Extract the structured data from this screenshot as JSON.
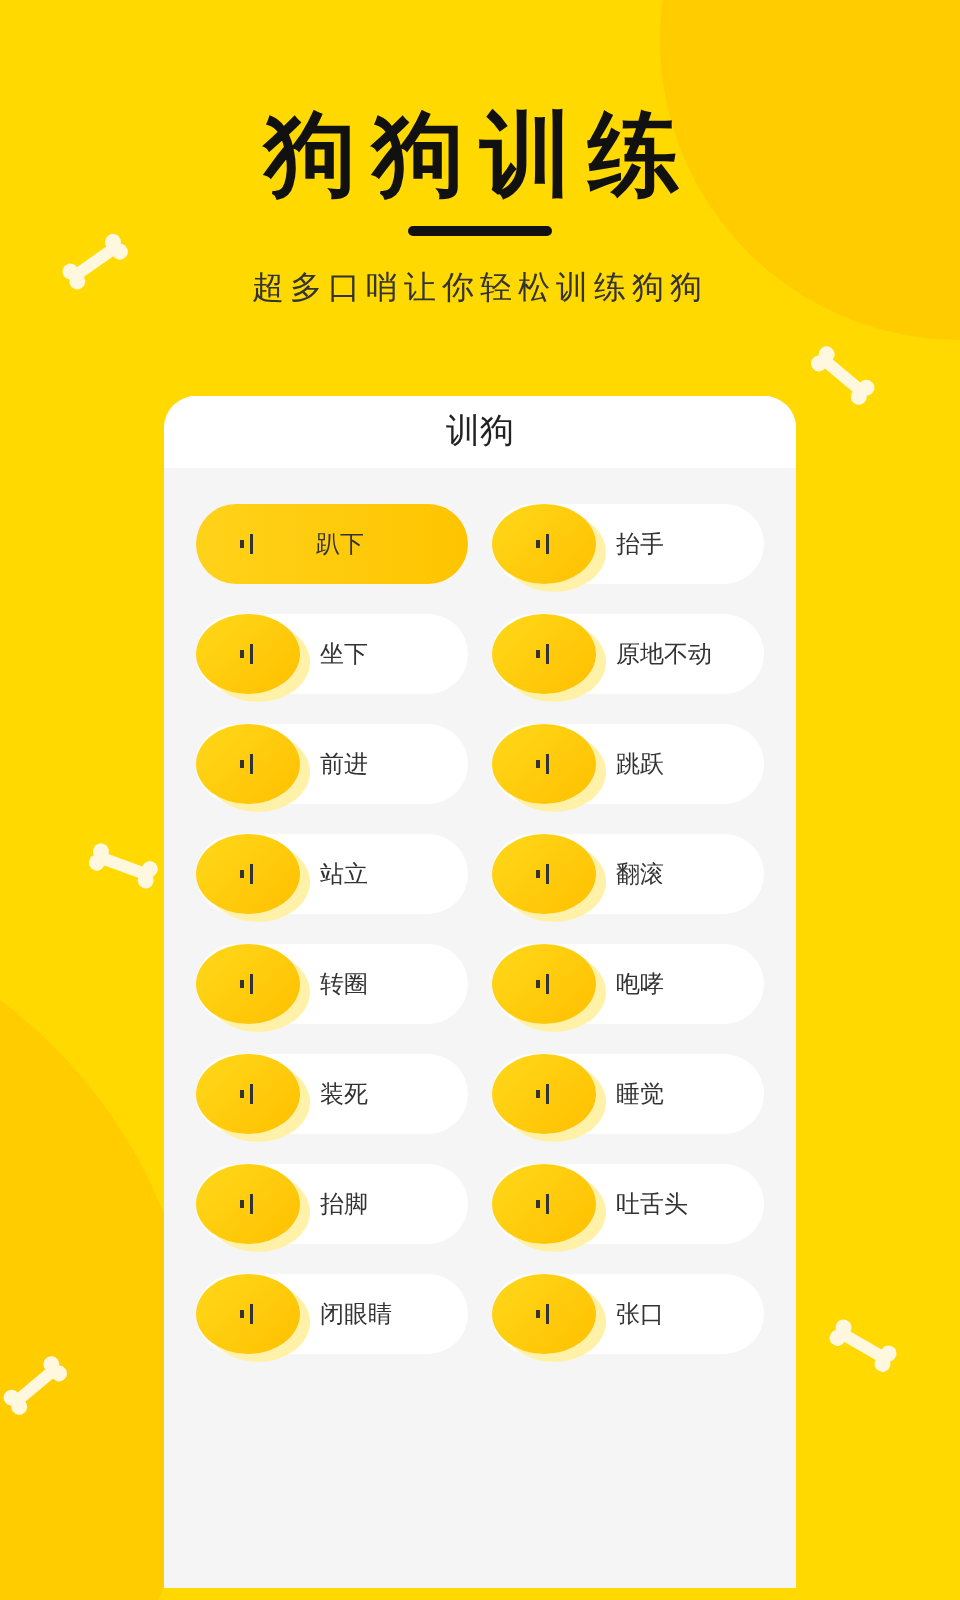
{
  "header": {
    "title": "狗狗训练",
    "subtitle": "超多口哨让你轻松训练狗狗"
  },
  "panel": {
    "title": "训狗",
    "commands": [
      {
        "label": "趴下",
        "selected": true
      },
      {
        "label": "抬手",
        "selected": false
      },
      {
        "label": "坐下",
        "selected": false
      },
      {
        "label": "原地不动",
        "selected": false
      },
      {
        "label": "前进",
        "selected": false
      },
      {
        "label": "跳跃",
        "selected": false
      },
      {
        "label": "站立",
        "selected": false
      },
      {
        "label": "翻滚",
        "selected": false
      },
      {
        "label": "转圈",
        "selected": false
      },
      {
        "label": "咆哮",
        "selected": false
      },
      {
        "label": "装死",
        "selected": false
      },
      {
        "label": "睡觉",
        "selected": false
      },
      {
        "label": "抬脚",
        "selected": false
      },
      {
        "label": "吐舌头",
        "selected": false
      },
      {
        "label": "闭眼睛",
        "selected": false
      },
      {
        "label": "张口",
        "selected": false
      }
    ]
  }
}
